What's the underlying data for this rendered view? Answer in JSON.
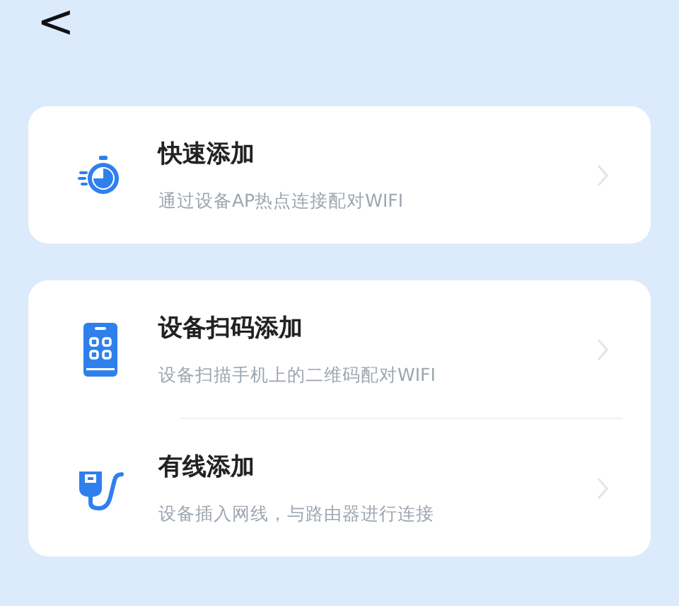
{
  "nav": {
    "back": "<"
  },
  "cards": [
    {
      "items": [
        {
          "kind": "stopwatch",
          "title": "快速添加",
          "subtitle": "通过设备AP热点连接配对WIFI"
        }
      ]
    },
    {
      "items": [
        {
          "kind": "phone",
          "title": "设备扫码添加",
          "subtitle": "设备扫描手机上的二维码配对WIFI"
        },
        {
          "kind": "cable",
          "title": "有线添加",
          "subtitle": "设备插入网线，与路由器进行连接"
        }
      ]
    }
  ]
}
